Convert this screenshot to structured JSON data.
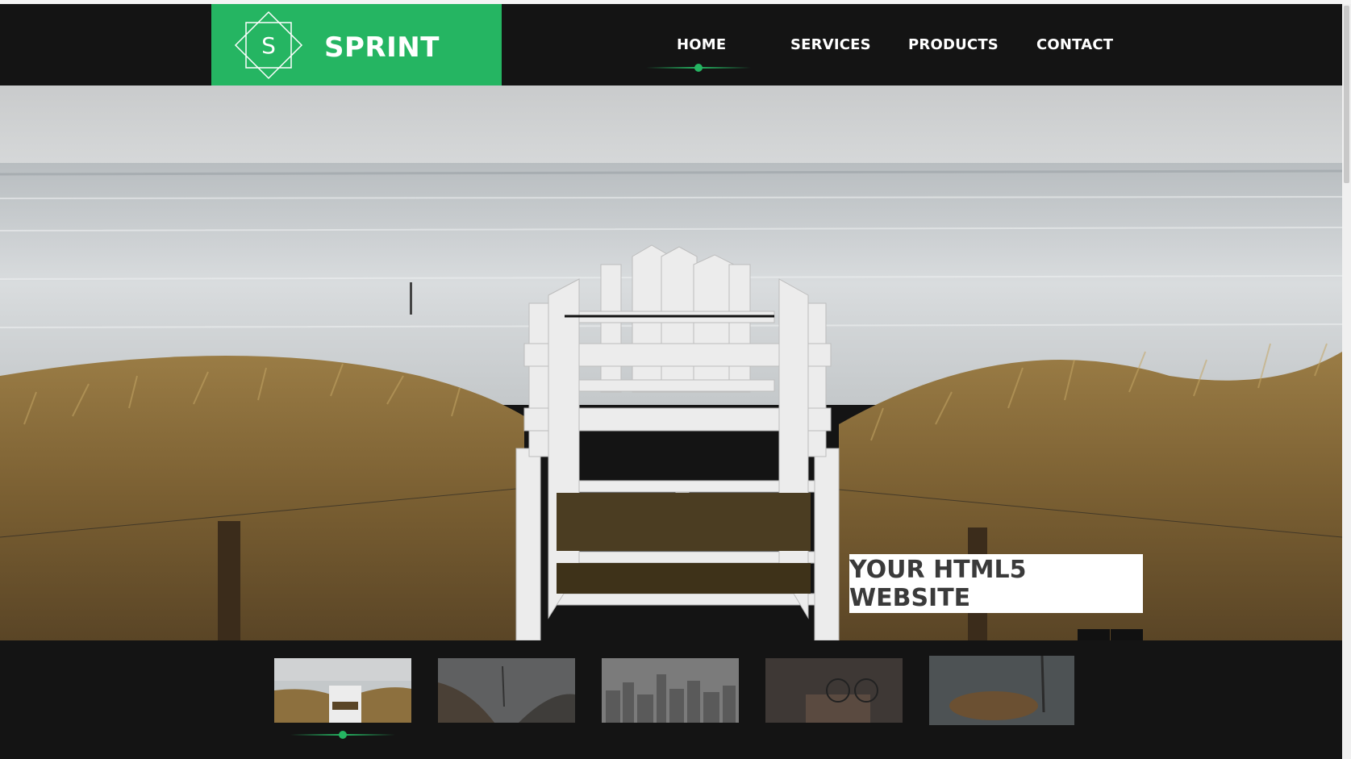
{
  "brand": {
    "initial": "S",
    "name": "SPRINT",
    "color": "#25b562"
  },
  "nav": {
    "items": [
      {
        "label": "HOME",
        "active": true
      },
      {
        "label": "SERVICES",
        "active": false
      },
      {
        "label": "PRODUCTS",
        "active": false
      },
      {
        "label": "CONTACT",
        "active": false
      }
    ]
  },
  "hero": {
    "caption": "YOUR HTML5 WEBSITE",
    "prev_icon": "chevron-left-icon",
    "next_icon": "chevron-right-icon"
  },
  "thumbnails": {
    "active_index": 0,
    "items": [
      {
        "scene": "beach-stairs"
      },
      {
        "scene": "misty-forest"
      },
      {
        "scene": "city-skyline"
      },
      {
        "scene": "street-bicycles"
      },
      {
        "scene": "log-pile"
      }
    ]
  },
  "colors": {
    "header_bg": "#141414",
    "accent": "#25b562",
    "caption_text": "#3a3a3a"
  }
}
